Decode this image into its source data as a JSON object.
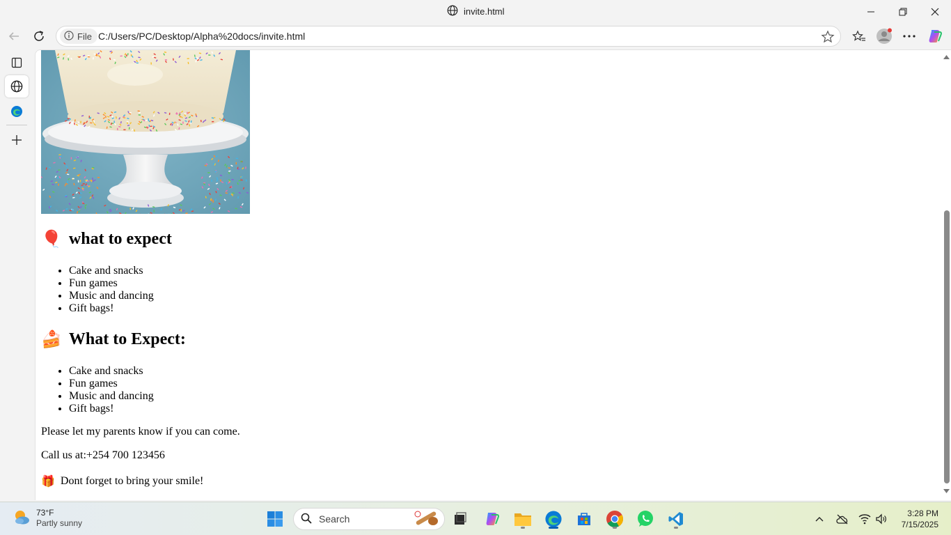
{
  "window": {
    "title": "invite.html"
  },
  "addressbar": {
    "scheme_label": "File",
    "url": "C:/Users/PC/Desktop/Alpha%20docs/invite.html"
  },
  "page": {
    "section1": {
      "emoji": "🎈",
      "heading": "what to expect",
      "items": [
        "Cake and snacks",
        "Fun games",
        "Music and dancing",
        "Gift bags!"
      ]
    },
    "section2": {
      "emoji": "🍰",
      "heading": "What to Expect:",
      "items": [
        "Cake and snacks",
        "Fun games",
        "Music and dancing",
        "Gift bags!"
      ]
    },
    "rsvp_text": "Please let my parents know if you can come.",
    "call_text": "Call us at:+254 700 123456",
    "closing_emoji": "🎁",
    "closing_text": "Dont forget to bring your smile!"
  },
  "taskbar": {
    "weather_temp": "73°F",
    "weather_desc": "Partly sunny",
    "search_placeholder": "Search",
    "time": "3:28 PM",
    "date": "7/15/2025"
  },
  "colors": {
    "page_bg": "#ffffff",
    "chrome_bg": "#f3f3f3",
    "edge_blue": "#0a7bd6"
  }
}
